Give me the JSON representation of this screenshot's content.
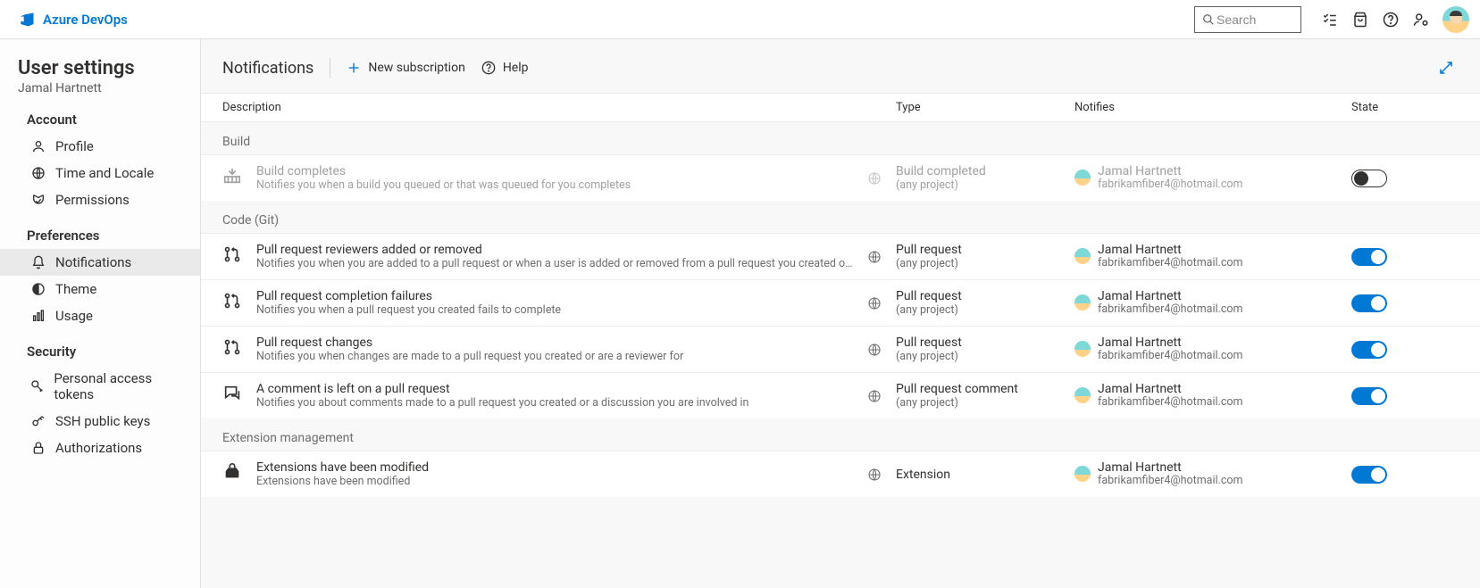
{
  "product": "Azure DevOps",
  "search": {
    "placeholder": "Search"
  },
  "page_title": "User settings",
  "user_name": "Jamal Hartnett",
  "nav": {
    "groups": [
      {
        "title": "Account",
        "items": [
          {
            "id": "profile",
            "label": "Profile"
          },
          {
            "id": "time-locale",
            "label": "Time and Locale"
          },
          {
            "id": "permissions",
            "label": "Permissions"
          }
        ]
      },
      {
        "title": "Preferences",
        "items": [
          {
            "id": "notifications",
            "label": "Notifications",
            "active": true
          },
          {
            "id": "theme",
            "label": "Theme"
          },
          {
            "id": "usage",
            "label": "Usage"
          }
        ]
      },
      {
        "title": "Security",
        "items": [
          {
            "id": "pat",
            "label": "Personal access tokens"
          },
          {
            "id": "ssh",
            "label": "SSH public keys"
          },
          {
            "id": "auth",
            "label": "Authorizations"
          }
        ]
      }
    ]
  },
  "content": {
    "title": "Notifications",
    "actions": {
      "new": "New subscription",
      "help": "Help"
    },
    "columns": {
      "description": "Description",
      "type": "Type",
      "notifies": "Notifies",
      "state": "State"
    },
    "notifier": {
      "name": "Jamal Hartnett",
      "email": "fabrikamfiber4@hotmail.com"
    },
    "groups": [
      {
        "label": "Build",
        "items": [
          {
            "icon": "build",
            "title": "Build completes",
            "desc": "Notifies you when a build you queued or that was queued for you completes",
            "type_main": "Build completed",
            "type_sub": "(any project)",
            "enabled": false
          }
        ]
      },
      {
        "label": "Code (Git)",
        "items": [
          {
            "icon": "pull-request",
            "title": "Pull request reviewers added or removed",
            "desc": "Notifies you when you are added to a pull request or when a user is added or removed from a pull request you created or are a reviewer for",
            "type_main": "Pull request",
            "type_sub": "(any project)",
            "enabled": true
          },
          {
            "icon": "pull-request",
            "title": "Pull request completion failures",
            "desc": "Notifies you when a pull request you created fails to complete",
            "type_main": "Pull request",
            "type_sub": "(any project)",
            "enabled": true
          },
          {
            "icon": "pull-request",
            "title": "Pull request changes",
            "desc": "Notifies you when changes are made to a pull request you created or are a reviewer for",
            "type_main": "Pull request",
            "type_sub": "(any project)",
            "enabled": true
          },
          {
            "icon": "comment",
            "title": "A comment is left on a pull request",
            "desc": "Notifies you about comments made to a pull request you created or a discussion you are involved in",
            "type_main": "Pull request comment",
            "type_sub": "(any project)",
            "enabled": true
          }
        ]
      },
      {
        "label": "Extension management",
        "items": [
          {
            "icon": "extension",
            "title": "Extensions have been modified",
            "desc": "Extensions have been modified",
            "type_main": "Extension",
            "type_sub": "",
            "enabled": true
          }
        ]
      }
    ]
  }
}
